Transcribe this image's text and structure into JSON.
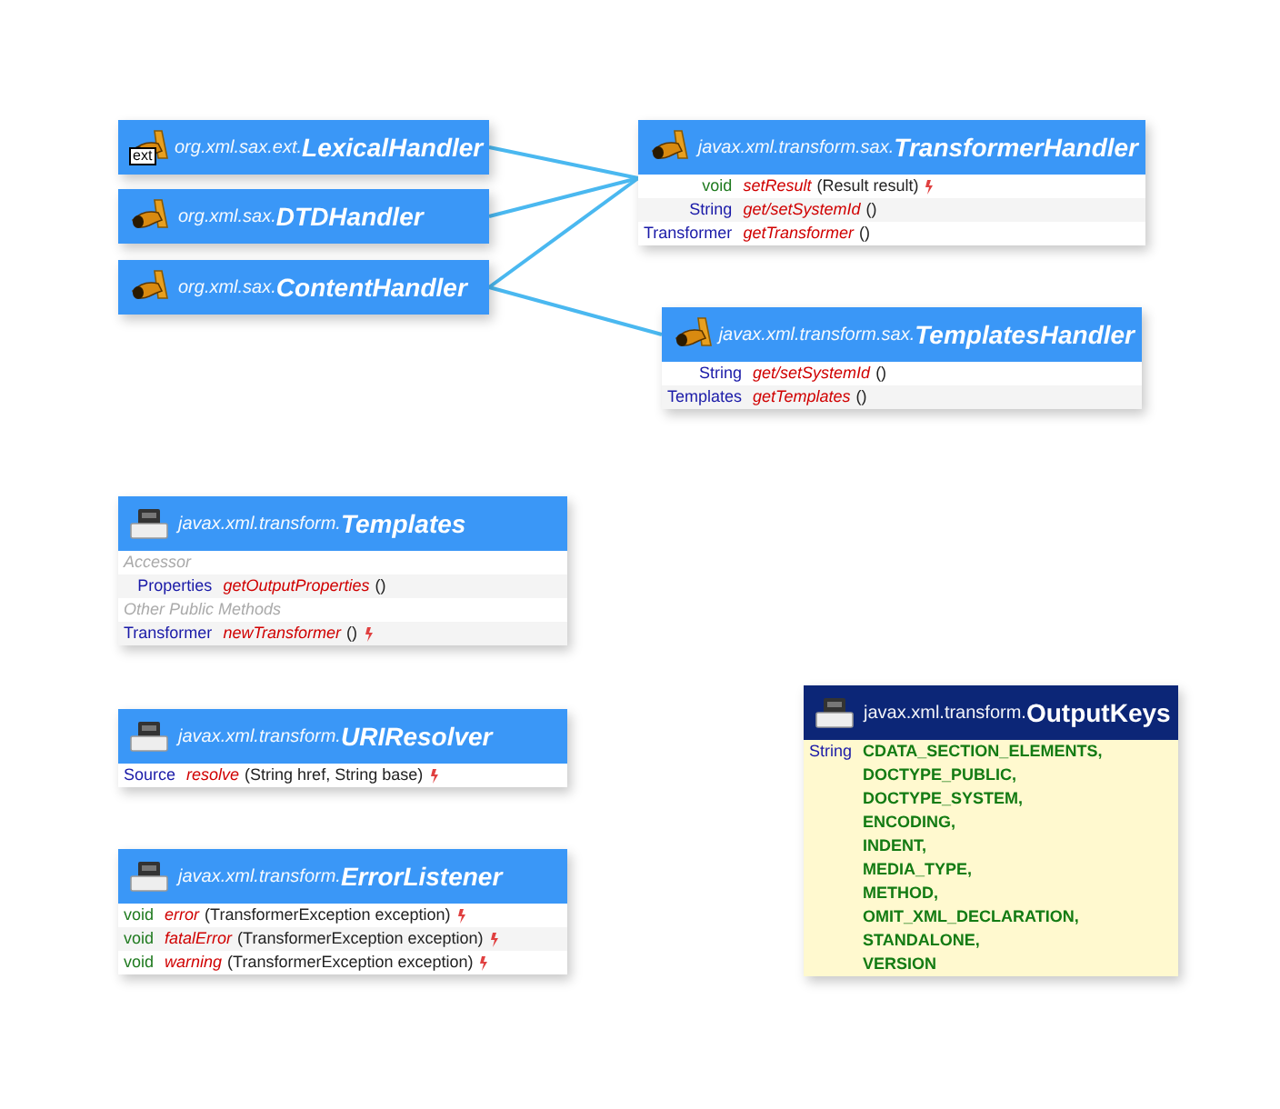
{
  "classes": [
    {
      "kind": "interface",
      "badge": "ext",
      "package": "org.xml.sax.ext.",
      "name": "LexicalHandler"
    },
    {
      "kind": "interface",
      "package": "org.xml.sax.",
      "name": "DTDHandler"
    },
    {
      "kind": "interface",
      "package": "org.xml.sax.",
      "name": "ContentHandler"
    },
    {
      "kind": "interface",
      "package": "javax.xml.transform.sax.",
      "name": "TransformerHandler",
      "members": [
        {
          "kind": "method",
          "primitive": true,
          "type": "void",
          "name": "setResult",
          "params": "(Result result)",
          "throws": true
        },
        {
          "kind": "method",
          "primitive": false,
          "type": "String",
          "name": "get/setSystemId",
          "params": "()",
          "throws": false
        },
        {
          "kind": "method",
          "primitive": false,
          "type": "Transformer",
          "name": "getTransformer",
          "params": "()",
          "throws": false
        }
      ]
    },
    {
      "kind": "interface",
      "package": "javax.xml.transform.sax.",
      "name": "TemplatesHandler",
      "members": [
        {
          "kind": "method",
          "primitive": false,
          "type": "String",
          "name": "get/setSystemId",
          "params": "()",
          "throws": false
        },
        {
          "kind": "method",
          "primitive": false,
          "type": "Templates",
          "name": "getTemplates",
          "params": "()",
          "throws": false
        }
      ]
    },
    {
      "kind": "interface_class",
      "package": "javax.xml.transform.",
      "name": "Templates",
      "members": [
        {
          "kind": "section",
          "label": "Accessor"
        },
        {
          "kind": "method",
          "primitive": false,
          "type": "Properties",
          "name": "getOutputProperties",
          "params": "()",
          "throws": false
        },
        {
          "kind": "section",
          "label": "Other Public Methods"
        },
        {
          "kind": "method",
          "primitive": false,
          "type": "Transformer",
          "name": "newTransformer",
          "params": "()",
          "throws": true
        }
      ]
    },
    {
      "kind": "interface_class",
      "package": "javax.xml.transform.",
      "name": "URIResolver",
      "members": [
        {
          "kind": "method",
          "primitive": false,
          "type": "Source",
          "name": "resolve",
          "params": "(String href, String base)",
          "throws": true
        }
      ]
    },
    {
      "kind": "interface_class",
      "package": "javax.xml.transform.",
      "name": "ErrorListener",
      "members": [
        {
          "kind": "method",
          "primitive": true,
          "type": "void",
          "name": "error",
          "params": "(TransformerException exception)",
          "throws": true
        },
        {
          "kind": "method",
          "primitive": true,
          "type": "void",
          "name": "fatalError",
          "params": "(TransformerException exception)",
          "throws": true
        },
        {
          "kind": "method",
          "primitive": true,
          "type": "void",
          "name": "warning",
          "params": "(TransformerException exception)",
          "throws": true
        }
      ]
    },
    {
      "kind": "class",
      "package": "javax.xml.transform.",
      "name": "OutputKeys",
      "members": [
        {
          "kind": "constant",
          "type": "String",
          "name": "CDATA_SECTION_ELEMENTS,"
        },
        {
          "kind": "constant",
          "name": "DOCTYPE_PUBLIC,"
        },
        {
          "kind": "constant",
          "name": "DOCTYPE_SYSTEM,"
        },
        {
          "kind": "constant",
          "name": "ENCODING,"
        },
        {
          "kind": "constant",
          "name": "INDENT,"
        },
        {
          "kind": "constant",
          "name": "MEDIA_TYPE,"
        },
        {
          "kind": "constant",
          "name": "METHOD,"
        },
        {
          "kind": "constant",
          "name": "OMIT_XML_DECLARATION,"
        },
        {
          "kind": "constant",
          "name": "STANDALONE,"
        },
        {
          "kind": "constant",
          "name": "VERSION"
        }
      ]
    }
  ]
}
